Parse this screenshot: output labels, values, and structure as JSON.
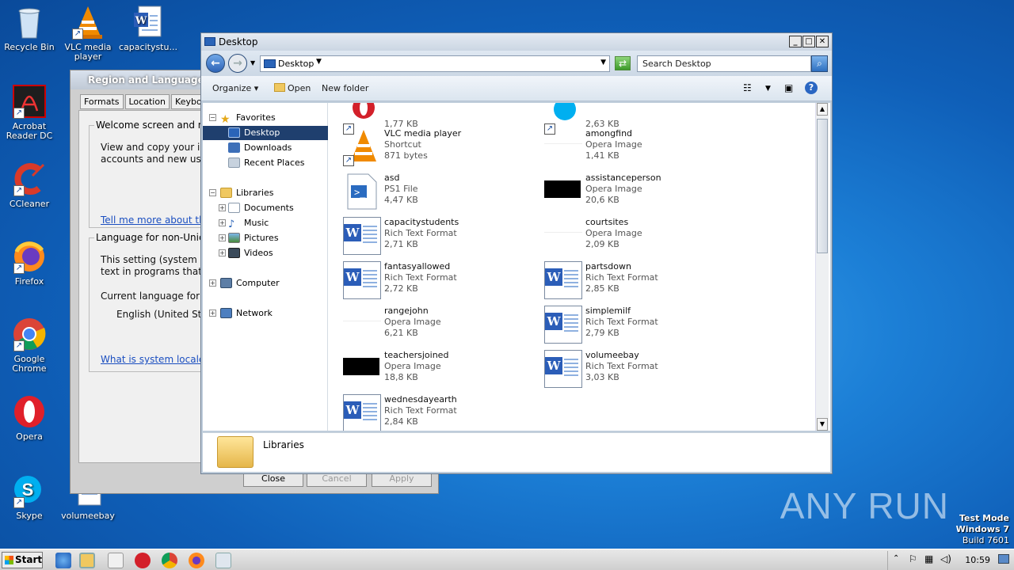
{
  "desktop": {
    "icons": [
      {
        "label": "Recycle Bin"
      },
      {
        "label": "VLC media player"
      },
      {
        "label": "capacitystu..."
      },
      {
        "label": "Acrobat Reader DC"
      },
      {
        "label": "CCleaner"
      },
      {
        "label": "Firefox"
      },
      {
        "label": "Google Chrome"
      },
      {
        "label": "Opera"
      },
      {
        "label": "Skype"
      },
      {
        "label": "volumeebay"
      }
    ],
    "watermark": "ANY RUN",
    "os_info": {
      "line1": "Test Mode",
      "line2": "Windows 7",
      "line3": "Build 7601"
    }
  },
  "region_dialog": {
    "title": "Region and Language",
    "tabs": [
      "Formats",
      "Location",
      "Keyboard"
    ],
    "group1_label": "Welcome screen and new",
    "group1_text1": "View and copy your inte",
    "group1_text2": "accounts and new user a",
    "link1": "Tell me more about the",
    "group2_label": "Language for non-Unicod",
    "group2_text1": "This setting (system loca",
    "group2_text2": "text in programs that do",
    "current_label": "Current language for no",
    "current_value": "English (United State",
    "link2": "What is system locale?",
    "buttons": {
      "close": "Close",
      "cancel": "Cancel",
      "apply": "Apply"
    }
  },
  "explorer": {
    "title": "Desktop",
    "address": "Desktop",
    "search_placeholder": "Search Desktop",
    "toolbar": {
      "organize": "Organize",
      "open": "Open",
      "new_folder": "New folder"
    },
    "nav": {
      "favorites": "Favorites",
      "desktop": "Desktop",
      "downloads": "Downloads",
      "recent": "Recent Places",
      "libraries": "Libraries",
      "documents": "Documents",
      "music": "Music",
      "pictures": "Pictures",
      "videos": "Videos",
      "computer": "Computer",
      "network": "Network"
    },
    "files_left": [
      {
        "name": "",
        "type": "",
        "size": "1,77 KB",
        "icon": "opera-icon"
      },
      {
        "name": "VLC media player",
        "type": "Shortcut",
        "size": "871 bytes",
        "icon": "vlc-icon"
      },
      {
        "name": "asd",
        "type": "PS1 File",
        "size": "4,47 KB",
        "icon": "powershell-icon"
      },
      {
        "name": "capacitystudents",
        "type": "Rich Text Format",
        "size": "2,71 KB",
        "icon": "word-icon"
      },
      {
        "name": "fantasyallowed",
        "type": "Rich Text Format",
        "size": "2,72 KB",
        "icon": "word-icon"
      },
      {
        "name": "rangejohn",
        "type": "Opera Image",
        "size": "6,21 KB",
        "icon": "blank-image"
      },
      {
        "name": "teachersjoined",
        "type": "Opera Image",
        "size": "18,8 KB",
        "icon": "black-image"
      },
      {
        "name": "wednesdayearth",
        "type": "Rich Text Format",
        "size": "2,84 KB",
        "icon": "word-icon"
      }
    ],
    "files_right": [
      {
        "name": "",
        "type": "",
        "size": "2,63 KB",
        "icon": "skype-icon"
      },
      {
        "name": "amongfind",
        "type": "Opera Image",
        "size": "1,41 KB",
        "icon": "blank-image"
      },
      {
        "name": "assistanceperson",
        "type": "Opera Image",
        "size": "20,6 KB",
        "icon": "black-image"
      },
      {
        "name": "courtsites",
        "type": "Opera Image",
        "size": "2,09 KB",
        "icon": "blank-image"
      },
      {
        "name": "partsdown",
        "type": "Rich Text Format",
        "size": "2,85 KB",
        "icon": "word-icon"
      },
      {
        "name": "simplemilf",
        "type": "Rich Text Format",
        "size": "2,79 KB",
        "icon": "word-icon"
      },
      {
        "name": "volumeebay",
        "type": "Rich Text Format",
        "size": "3,03 KB",
        "icon": "word-icon"
      }
    ],
    "details_label": "Libraries"
  },
  "taskbar": {
    "start": "Start",
    "clock": "10:59"
  }
}
